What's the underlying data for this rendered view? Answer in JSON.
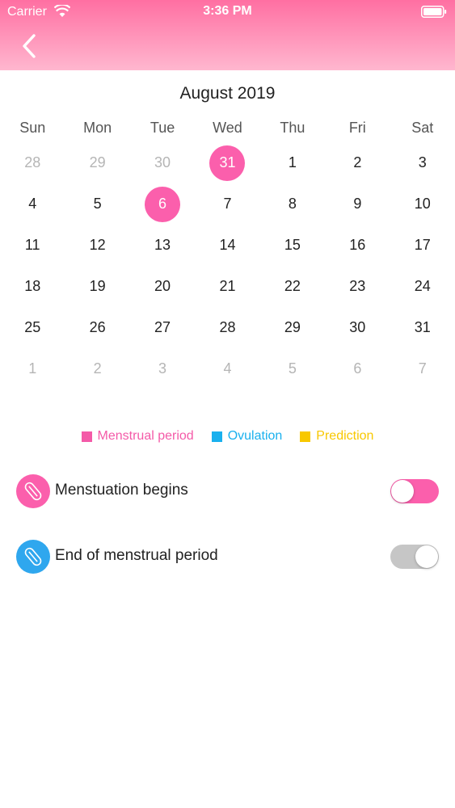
{
  "status_bar": {
    "carrier": "Carrier",
    "time": "3:36 PM"
  },
  "calendar": {
    "month_title": "August 2019",
    "weekdays": [
      "Sun",
      "Mon",
      "Tue",
      "Wed",
      "Thu",
      "Fri",
      "Sat"
    ],
    "weeks": [
      [
        {
          "day": "28",
          "muted": true
        },
        {
          "day": "29",
          "muted": true
        },
        {
          "day": "30",
          "muted": true
        },
        {
          "day": "31",
          "muted": false,
          "marked": true
        },
        {
          "day": "1",
          "muted": false
        },
        {
          "day": "2",
          "muted": false
        },
        {
          "day": "3",
          "muted": false
        }
      ],
      [
        {
          "day": "4",
          "muted": false
        },
        {
          "day": "5",
          "muted": false
        },
        {
          "day": "6",
          "muted": false,
          "marked": true
        },
        {
          "day": "7",
          "muted": false
        },
        {
          "day": "8",
          "muted": false
        },
        {
          "day": "9",
          "muted": false
        },
        {
          "day": "10",
          "muted": false
        }
      ],
      [
        {
          "day": "11",
          "muted": false
        },
        {
          "day": "12",
          "muted": false
        },
        {
          "day": "13",
          "muted": false
        },
        {
          "day": "14",
          "muted": false
        },
        {
          "day": "15",
          "muted": false
        },
        {
          "day": "16",
          "muted": false
        },
        {
          "day": "17",
          "muted": false
        }
      ],
      [
        {
          "day": "18",
          "muted": false
        },
        {
          "day": "19",
          "muted": false
        },
        {
          "day": "20",
          "muted": false
        },
        {
          "day": "21",
          "muted": false
        },
        {
          "day": "22",
          "muted": false
        },
        {
          "day": "23",
          "muted": false
        },
        {
          "day": "24",
          "muted": false
        }
      ],
      [
        {
          "day": "25",
          "muted": false
        },
        {
          "day": "26",
          "muted": false
        },
        {
          "day": "27",
          "muted": false
        },
        {
          "day": "28",
          "muted": false
        },
        {
          "day": "29",
          "muted": false
        },
        {
          "day": "30",
          "muted": false
        },
        {
          "day": "31",
          "muted": false
        }
      ],
      [
        {
          "day": "1",
          "muted": true
        },
        {
          "day": "2",
          "muted": true
        },
        {
          "day": "3",
          "muted": true
        },
        {
          "day": "4",
          "muted": true
        },
        {
          "day": "5",
          "muted": true
        },
        {
          "day": "6",
          "muted": true
        },
        {
          "day": "7",
          "muted": true
        }
      ]
    ],
    "marker_color": "#fb5fac"
  },
  "legend": [
    {
      "label": "Menstrual period",
      "color": "#f45aa8"
    },
    {
      "label": "Ovulation",
      "color": "#19b0ee"
    },
    {
      "label": "Prediction",
      "color": "#f8c800"
    }
  ],
  "settings": [
    {
      "label": "Menstuation begins",
      "icon": "pad-icon",
      "icon_color": "#fb5fac",
      "toggle_on": true,
      "toggle_color": "#fb5fac"
    },
    {
      "label": "End of menstrual period",
      "icon": "pad-icon",
      "icon_color": "#2fa7ee",
      "toggle_on": false,
      "toggle_color": "#c6c6c6"
    }
  ],
  "colors": {
    "header_top": "#ff6fa2",
    "header_bottom": "#ffb7cf"
  }
}
